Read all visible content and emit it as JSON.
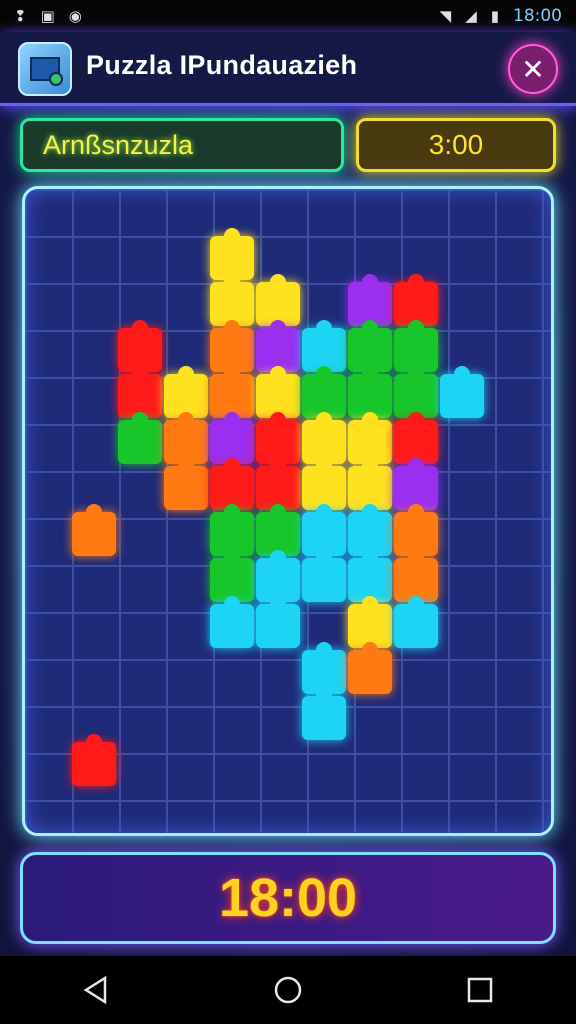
{
  "status_bar": {
    "time": "18:00",
    "icons": [
      "notification-icon",
      "image-icon",
      "sync-icon",
      "wifi-icon",
      "signal-icon",
      "battery-icon"
    ]
  },
  "app_bar": {
    "title": "Puzzla IPundauazieh",
    "close_icon": "close-icon"
  },
  "info": {
    "mode_label": "Arnßsnzuzla",
    "timer": "3:00"
  },
  "board": {
    "colors": [
      "#ff1a1a",
      "#ff7a12",
      "#ffe21f",
      "#18c62b",
      "#1ed4f5",
      "#9a2ff0",
      "#1e5be0"
    ]
  },
  "bottom": {
    "big_timer": "18:00"
  },
  "nav": {
    "icons": [
      "back-icon",
      "home-icon",
      "recents-icon"
    ]
  }
}
